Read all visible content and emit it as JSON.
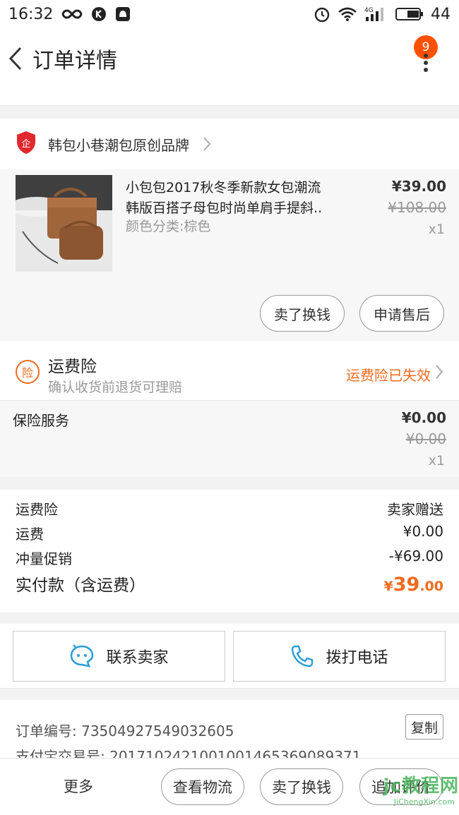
{
  "status_bar": {
    "time": "16:32",
    "network": "4G",
    "battery": "44"
  },
  "nav": {
    "title": "订单详情",
    "badge_count": "9"
  },
  "shop": {
    "name": "韩包小巷潮包原创品牌"
  },
  "item": {
    "title_line1": "小包包2017秋冬季新款女包潮流",
    "title_line2": "韩版百搭子母包时尚单肩手提斜..",
    "sku": "颜色分类:棕色",
    "price": "¥39.00",
    "original_price": "¥108.00",
    "quantity": "x1",
    "actions": [
      "卖了换钱",
      "申请售后"
    ]
  },
  "shipping_insurance": {
    "title": "运费险",
    "subtitle": "确认收货前退货可理赔",
    "status": "运费险已失效",
    "status_color": "#f06b1e"
  },
  "service": {
    "label": "保险服务",
    "price": "¥0.00",
    "original_price": "¥0.00",
    "quantity": "x1"
  },
  "summary": {
    "rows": [
      {
        "label": "运费险",
        "value": "卖家赠送"
      },
      {
        "label": "运费",
        "value": "¥0.00"
      },
      {
        "label": "冲量促销",
        "value": "-¥69.00"
      }
    ],
    "total_label": "实付款（含运费）",
    "total_symbol": "¥",
    "total_int": "39",
    "total_dec": ".00"
  },
  "contact": {
    "seller_label": "联系卖家",
    "phone_label": "拨打电话"
  },
  "order_info": {
    "order_no_label": "订单编号: 73504927549032605",
    "alipay_label": "支付宝交易号: 2017102421001001465369089371",
    "copy_label": "复制"
  },
  "bottom_bar": {
    "more_label": "更多",
    "buttons": [
      "查看物流",
      "卖了换钱",
      "追加评价"
    ]
  },
  "watermark": {
    "top": "jc教程网",
    "bottom": "JiChengXin.com"
  },
  "colors": {
    "accent": "#f06b1e",
    "badge": "#ff5000",
    "shop_icon": "#e0282e",
    "contact_icon": "#2a9fd6"
  }
}
